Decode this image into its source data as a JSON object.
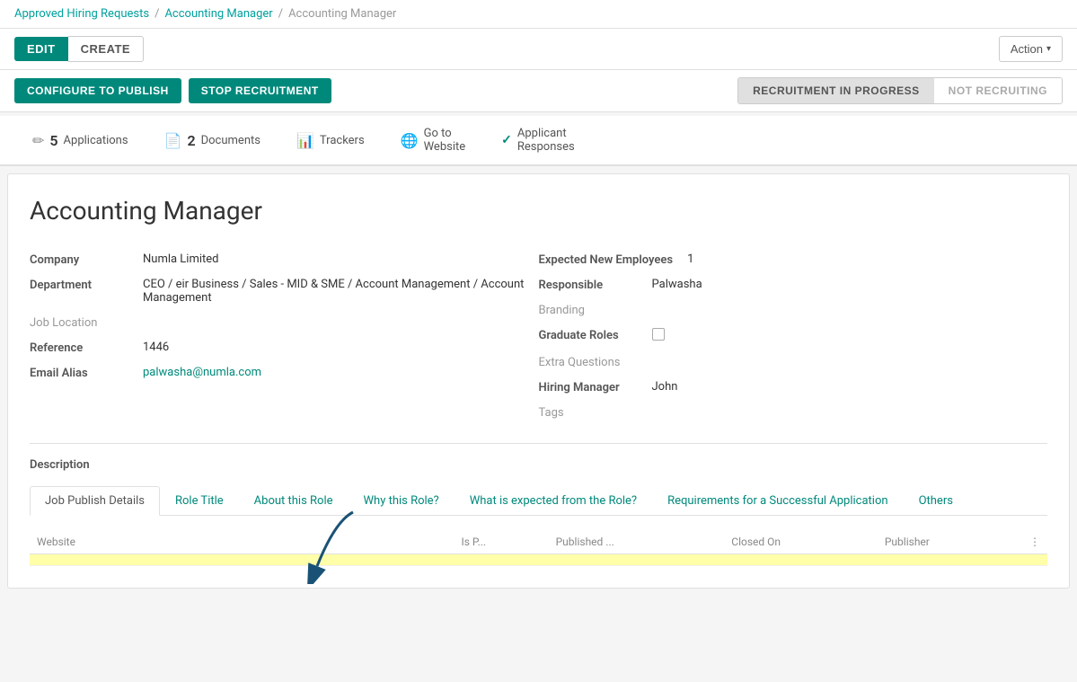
{
  "breadcrumb": {
    "items": [
      {
        "label": "Approved Hiring Requests",
        "type": "link"
      },
      {
        "label": "/",
        "type": "sep"
      },
      {
        "label": "Accounting Manager",
        "type": "link"
      },
      {
        "label": "/",
        "type": "sep"
      },
      {
        "label": "Accounting Manager",
        "type": "current"
      }
    ]
  },
  "toolbar": {
    "edit_label": "EDIT",
    "create_label": "CREATE",
    "action_label": "Action",
    "action_arrow": "▾"
  },
  "status_bar": {
    "configure_label": "CONFIGURE TO PUBLISH",
    "stop_label": "STOP RECRUITMENT",
    "status_active": "RECRUITMENT IN PROGRESS",
    "status_inactive": "NOT RECRUITING"
  },
  "tabs": [
    {
      "id": "applications",
      "count": "5",
      "label": "Applications",
      "icon": "✏"
    },
    {
      "id": "documents",
      "count": "2",
      "label": "Documents",
      "icon": "📄"
    },
    {
      "id": "trackers",
      "count": "",
      "label": "Trackers",
      "icon": "📊"
    },
    {
      "id": "website",
      "count": "",
      "label": "Go to\nWebsite",
      "icon": "🌐"
    },
    {
      "id": "applicant",
      "count": "",
      "label": "Applicant\nResponses",
      "icon": "✓"
    }
  ],
  "record": {
    "title": "Accounting Manager",
    "fields_left": [
      {
        "label": "Company",
        "value": "Numla Limited",
        "type": "normal"
      },
      {
        "label": "Department",
        "value": "CEO / eir Business / Sales - MID & SME / Account Management / Account Management",
        "type": "normal"
      },
      {
        "label": "Job Location",
        "value": "",
        "type": "optional"
      },
      {
        "label": "Reference",
        "value": "1446",
        "type": "normal"
      },
      {
        "label": "Email Alias",
        "value": "palwasha@numla.com",
        "type": "link"
      }
    ],
    "fields_right": [
      {
        "label": "Expected New Employees",
        "value": "1",
        "type": "normal"
      },
      {
        "label": "Responsible",
        "value": "Palwasha",
        "type": "normal"
      },
      {
        "label": "Branding",
        "value": "",
        "type": "optional"
      },
      {
        "label": "Graduate Roles",
        "value": "checkbox",
        "type": "checkbox"
      },
      {
        "label": "Extra Questions",
        "value": "",
        "type": "optional"
      },
      {
        "label": "Hiring Manager",
        "value": "John",
        "type": "normal"
      },
      {
        "label": "Tags",
        "value": "",
        "type": "optional"
      }
    ],
    "description_label": "Description",
    "desc_tabs": [
      {
        "id": "job-publish",
        "label": "Job Publish Details",
        "active": true
      },
      {
        "id": "role-title",
        "label": "Role Title",
        "active": false
      },
      {
        "id": "about-role",
        "label": "About this Role",
        "active": false
      },
      {
        "id": "why-role",
        "label": "Why this Role?",
        "active": false
      },
      {
        "id": "expected",
        "label": "What is expected from the Role?",
        "active": false
      },
      {
        "id": "requirements",
        "label": "Requirements for a Successful Application",
        "active": false
      },
      {
        "id": "others",
        "label": "Others",
        "active": false
      }
    ],
    "website_table": {
      "columns": [
        "Website",
        "",
        "Is P...",
        "Published ...",
        "Closed On",
        "Publisher",
        "⋮"
      ],
      "rows": [
        {
          "website": "",
          "is_p": "",
          "published": "",
          "closed": "",
          "publisher": "",
          "highlight": true
        }
      ]
    }
  }
}
